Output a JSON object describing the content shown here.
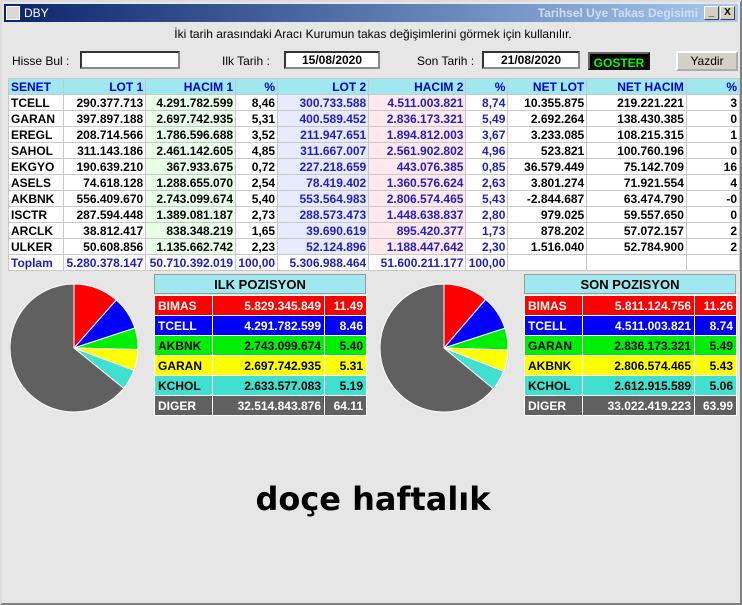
{
  "window": {
    "app": "DBY",
    "title": "Tarihsel Uye Takas Degisimi",
    "minimize": "_",
    "close": "X"
  },
  "hint": "İki tarih arasındaki  Aracı Kurumun takas değişimlerini görmek için kullanılır.",
  "form": {
    "search_label": "Hisse Bul :",
    "search_value": "",
    "start_label": "Ilk Tarih :",
    "start_value": "15/08/2020",
    "end_label": "Son Tarih :",
    "end_value": "21/08/2020",
    "go_label": "GOSTER",
    "print_label": "Yazdir"
  },
  "table": {
    "headers": [
      "SENET",
      "LOT 1",
      "HACIM 1",
      "%",
      "LOT 2",
      "HACIM 2",
      "%",
      "NET LOT",
      "NET HACIM",
      "%"
    ],
    "rows": [
      [
        "TCELL",
        "290.377.713",
        "4.291.782.599",
        "8,46",
        "300.733.588",
        "4.511.003.821",
        "8,74",
        "10.355.875",
        "219.221.221",
        "3"
      ],
      [
        "GARAN",
        "397.897.188",
        "2.697.742.935",
        "5,31",
        "400.589.452",
        "2.836.173.321",
        "5,49",
        "2.692.264",
        "138.430.385",
        "0"
      ],
      [
        "EREGL",
        "208.714.566",
        "1.786.596.688",
        "3,52",
        "211.947.651",
        "1.894.812.003",
        "3,67",
        "3.233.085",
        "108.215.315",
        "1"
      ],
      [
        "SAHOL",
        "311.143.186",
        "2.461.142.605",
        "4,85",
        "311.667.007",
        "2.561.902.802",
        "4,96",
        "523.821",
        "100.760.196",
        "0"
      ],
      [
        "EKGYO",
        "190.639.210",
        "367.933.675",
        "0,72",
        "227.218.659",
        "443.076.385",
        "0,85",
        "36.579.449",
        "75.142.709",
        "16"
      ],
      [
        "ASELS",
        "74.618.128",
        "1.288.655.070",
        "2,54",
        "78.419.402",
        "1.360.576.624",
        "2,63",
        "3.801.274",
        "71.921.554",
        "4"
      ],
      [
        "AKBNK",
        "556.409.670",
        "2.743.099.674",
        "5,40",
        "553.564.983",
        "2.806.574.465",
        "5,43",
        "-2.844.687",
        "63.474.790",
        "-0"
      ],
      [
        "ISCTR",
        "287.594.448",
        "1.389.081.187",
        "2,73",
        "288.573.473",
        "1.448.638.837",
        "2,80",
        "979.025",
        "59.557.650",
        "0"
      ],
      [
        "ARCLK",
        "38.812.417",
        "838.348.219",
        "1,65",
        "39.690.619",
        "895.420.377",
        "1,73",
        "878.202",
        "57.072.157",
        "2"
      ],
      [
        "ULKER",
        "50.608.856",
        "1.135.662.742",
        "2,23",
        "52.124.896",
        "1.188.447.642",
        "2,30",
        "1.516.040",
        "52.784.900",
        "2"
      ]
    ],
    "total": [
      "Toplam",
      "5.280.378.147",
      "50.710.392.019",
      "100,00",
      "5.306.988.464",
      "51.600.211.177",
      "100,00",
      "",
      "",
      ""
    ]
  },
  "ilk": {
    "title": "ILK POZISYON",
    "rows": [
      {
        "s": "BIMAS",
        "v": "5.829.345.849",
        "p": "11.49",
        "c": "#ff0000"
      },
      {
        "s": "TCELL",
        "v": "4.291.782.599",
        "p": "8.46",
        "c": "#0000ff"
      },
      {
        "s": "AKBNK",
        "v": "2.743.099.674",
        "p": "5.40",
        "c": "#00ee00"
      },
      {
        "s": "GARAN",
        "v": "2.697.742.935",
        "p": "5.31",
        "c": "#ffff00"
      },
      {
        "s": "KCHOL",
        "v": "2.633.577.083",
        "p": "5.19",
        "c": "#40e0d0"
      },
      {
        "s": "DIGER",
        "v": "32.514.843.876",
        "p": "64.11",
        "c": "#606060"
      }
    ]
  },
  "son": {
    "title": "SON POZISYON",
    "rows": [
      {
        "s": "BIMAS",
        "v": "5.811.124.756",
        "p": "11.26",
        "c": "#ff0000"
      },
      {
        "s": "TCELL",
        "v": "4.511.003.821",
        "p": "8.74",
        "c": "#0000ff"
      },
      {
        "s": "GARAN",
        "v": "2.836.173.321",
        "p": "5.49",
        "c": "#00ee00"
      },
      {
        "s": "AKBNK",
        "v": "2.806.574.465",
        "p": "5.43",
        "c": "#ffff00"
      },
      {
        "s": "KCHOL",
        "v": "2.612.915.589",
        "p": "5.06",
        "c": "#40e0d0"
      },
      {
        "s": "DIGER",
        "v": "33.022.419.223",
        "p": "63.99",
        "c": "#606060"
      }
    ]
  },
  "caption": "doçe haftalık"
}
